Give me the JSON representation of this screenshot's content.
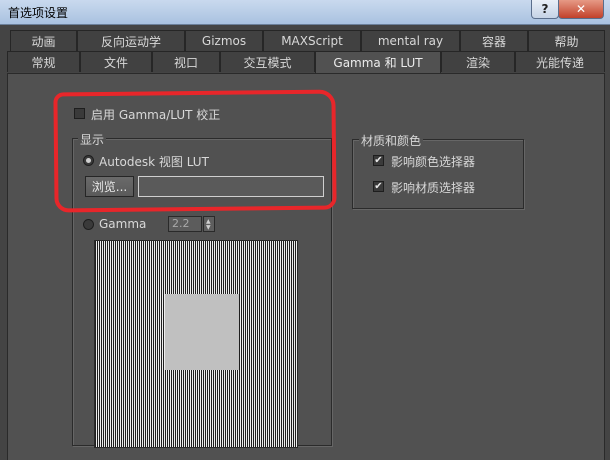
{
  "window": {
    "title": "首选项设置",
    "help": "?",
    "close": "✕"
  },
  "tabs_row1": [
    "动画",
    "反向运动学",
    "Gizmos",
    "MAXScript",
    "mental ray",
    "容器",
    "帮助"
  ],
  "tabs_row2": [
    "常规",
    "文件",
    "视口",
    "交互模式",
    "Gamma 和 LUT",
    "渲染",
    "光能传递"
  ],
  "active_tab": "Gamma 和 LUT",
  "gamma_lut": {
    "enable_label": "启用 Gamma/LUT 校正",
    "enabled": false,
    "display_group": "显示",
    "autodesk_lut_label": "Autodesk 视图 LUT",
    "browse_label": "浏览...",
    "lut_path": "",
    "gamma_label": "Gamma",
    "gamma_value": "2.2"
  },
  "materials": {
    "group_title": "材质和颜色",
    "affect_color_selector": "影响颜色选择器",
    "affect_material_selector": "影响材质选择器",
    "affect_color_checked": true,
    "affect_material_checked": true
  },
  "colors": {
    "highlight": "#e8262a",
    "panel": "#515151",
    "background": "#444444"
  }
}
